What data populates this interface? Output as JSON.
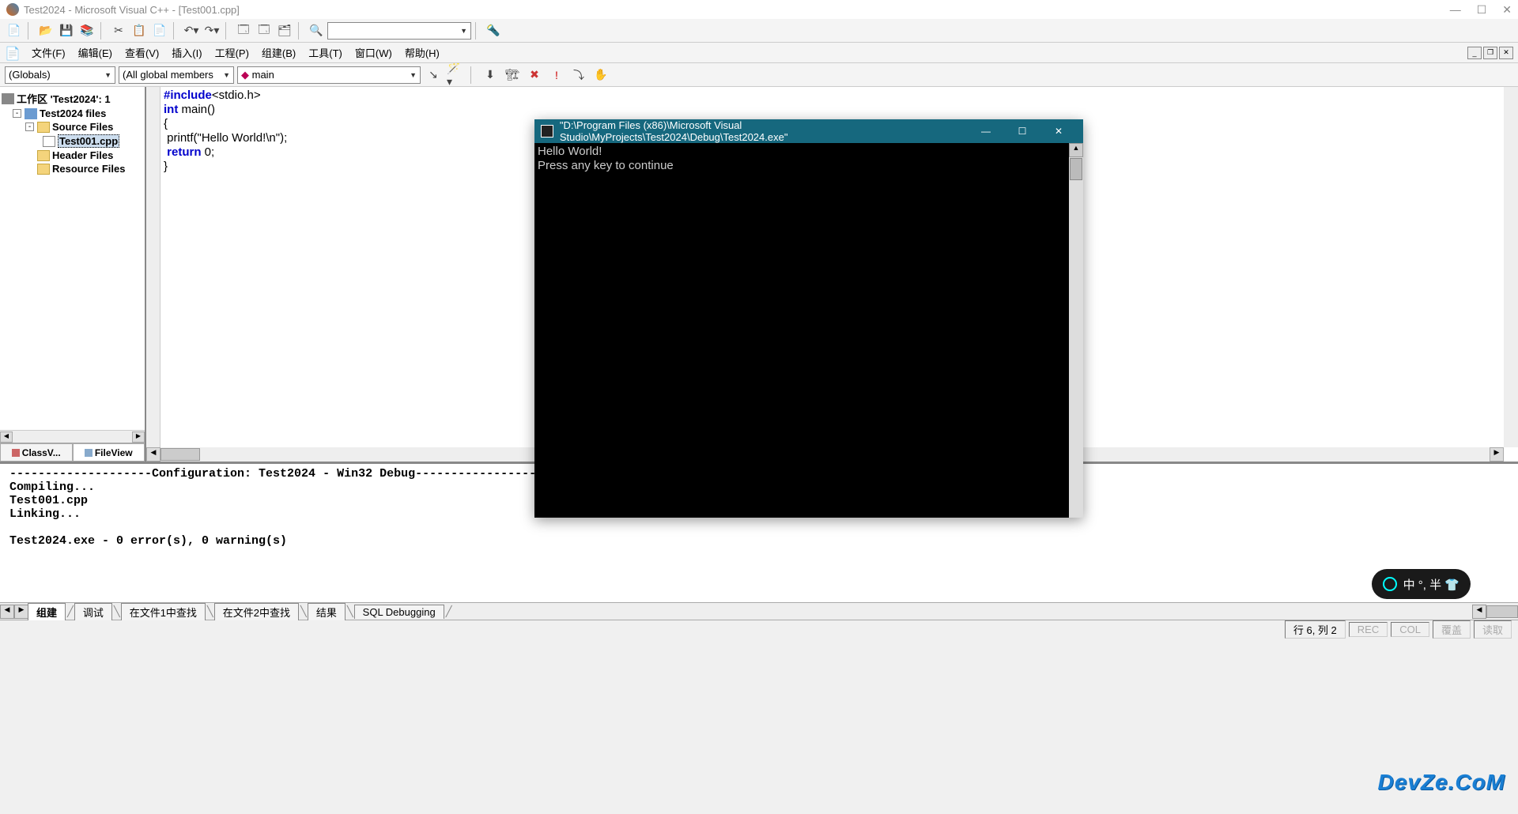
{
  "window": {
    "title": "Test2024 - Microsoft Visual C++ - [Test001.cpp]"
  },
  "menus": {
    "file": "文件(F)",
    "edit": "编辑(E)",
    "view": "查看(V)",
    "insert": "插入(I)",
    "project": "工程(P)",
    "build": "组建(B)",
    "tools": "工具(T)",
    "window": "窗口(W)",
    "help": "帮助(H)"
  },
  "combos": {
    "scope": "(Globals)",
    "members": "(All global members",
    "func": "main",
    "func_icon": "◆"
  },
  "tree": {
    "workspace": "工作区 'Test2024': 1 ",
    "project": "Test2024 files",
    "source_folder": "Source Files",
    "source_file": "Test001.cpp",
    "header_folder": "Header Files",
    "resource_folder": "Resource Files"
  },
  "side_tabs": {
    "class": "ClassV...",
    "file": "FileView"
  },
  "code": {
    "l1a": "#include",
    "l1b": "<stdio.h>",
    "l2a": "int",
    "l2b": " main()",
    "l3": "{",
    "l4": " printf(\"Hello World!\\n\");",
    "l5a": " return",
    "l5b": " 0;",
    "l6": "}"
  },
  "console": {
    "title": "\"D:\\Program Files (x86)\\Microsoft Visual Studio\\MyProjects\\Test2024\\Debug\\Test2024.exe\"",
    "line1": "Hello World!",
    "line2": "Press any key to continue"
  },
  "output": {
    "text": "--------------------Configuration: Test2024 - Win32 Debug--------------------\nCompiling...\nTest001.cpp\nLinking...\n\nTest2024.exe - 0 error(s), 0 warning(s)"
  },
  "output_tabs": {
    "build": "组建",
    "debug": "调试",
    "find1": "在文件1中查找",
    "find2": "在文件2中查找",
    "results": "结果",
    "sql": "SQL Debugging"
  },
  "status": {
    "position": "行 6, 列 2",
    "rec": "REC",
    "col": "COL",
    "over": "覆盖",
    "read": "读取"
  },
  "ime": {
    "text": "中 °, 半 👕"
  },
  "watermark": "DevZe.CoM"
}
